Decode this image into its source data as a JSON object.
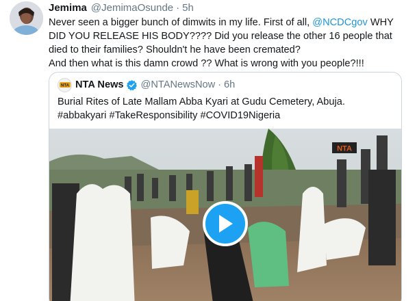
{
  "tweet": {
    "display_name": "Jemima",
    "handle": "@JemimaOsunde",
    "separator": "·",
    "time": "5h",
    "text": {
      "line1_part1": "Never seen a bigger bunch of dimwits in my life. First of all, ",
      "mention": "@NCDCgov",
      "line1_part2": " WHY DID YOU RELEASE HIS BODY???? Did you release the other 16 people that died to their families? Shouldn't he have been cremated?",
      "line2": "And then what is this damn crowd ?? What is wrong with you people?!!!"
    }
  },
  "quote": {
    "display_name": "NTA News",
    "handle": "@NTANewsNow",
    "separator": "·",
    "time": "6h",
    "text": "Burial Rites of Late Mallam Abba Kyari at Gudu Cemetery, Abuja. #abbakyari #TakeResponsibility #COVID19Nigeria",
    "logo_text": "NTA",
    "video_watermark": "NTA"
  },
  "colors": {
    "link": "#1b95e0",
    "play": "#1da1f2",
    "secondary_text": "#657786",
    "border": "#ccd6dd"
  },
  "icons": [
    "verified-badge-icon",
    "play-icon"
  ]
}
